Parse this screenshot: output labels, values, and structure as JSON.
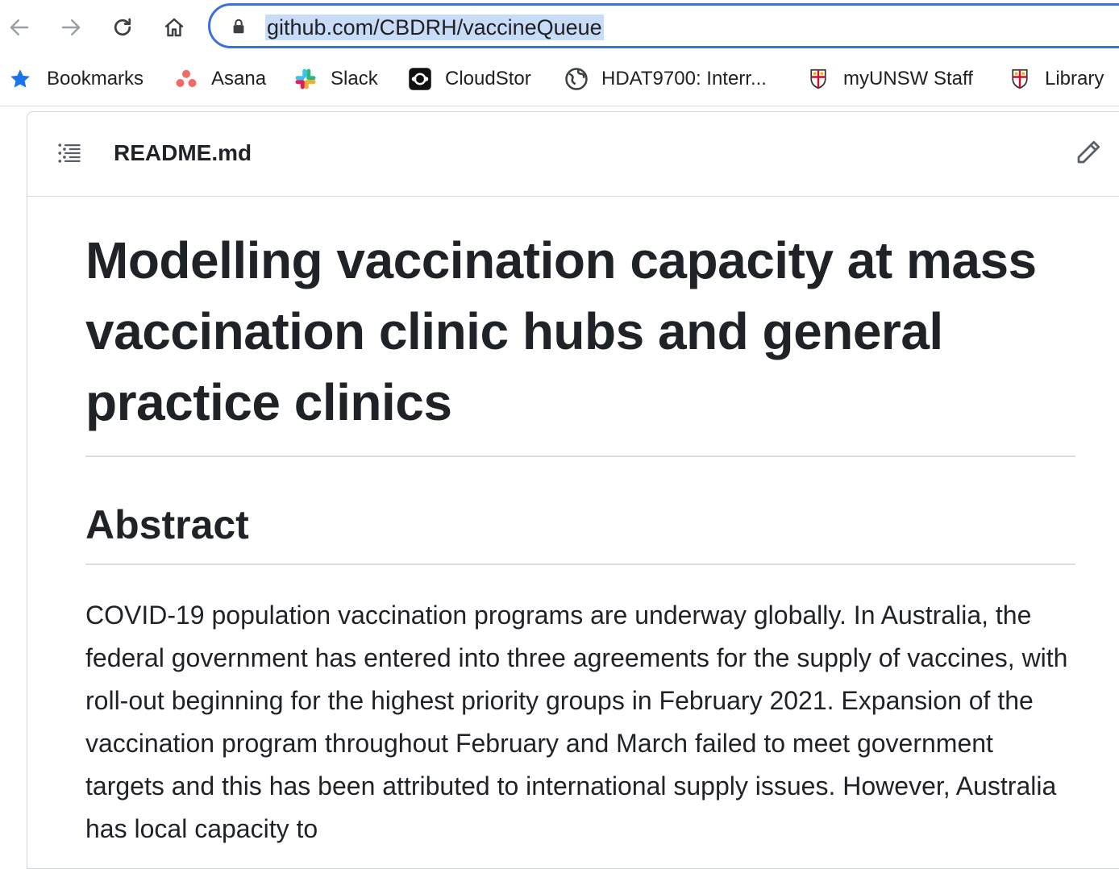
{
  "browser": {
    "url": "github.com/CBDRH/vaccineQueue",
    "nav": {
      "back_icon": "arrow-left-icon",
      "forward_icon": "arrow-right-icon",
      "reload_icon": "reload-icon",
      "home_icon": "home-icon"
    },
    "bookmarks": [
      {
        "label": "Bookmarks",
        "icon": "star-icon"
      },
      {
        "label": "Asana",
        "icon": "asana-icon"
      },
      {
        "label": "Slack",
        "icon": "slack-icon"
      },
      {
        "label": "CloudStor",
        "icon": "cloudstor-icon"
      },
      {
        "label": "HDAT9700: Interr...",
        "icon": "globe-icon"
      },
      {
        "label": "myUNSW Staff",
        "icon": "unsw-crest-icon"
      },
      {
        "label": "Library",
        "icon": "unsw-crest-icon"
      }
    ]
  },
  "readme": {
    "filename": "README.md",
    "title": "Modelling vaccination capacity at mass vaccination clinic hubs and general practice clinics",
    "section_heading": "Abstract",
    "abstract_visible": "COVID-19 population vaccination programs are underway globally. In Australia, the federal government has entered into three agreements for the supply of vaccines, with roll-out beginning for the highest priority groups in February 2021. Expansion of the vaccination program throughout February and March failed to meet government targets and this has been attributed to international supply issues. However, Australia has local capacity to"
  },
  "colors": {
    "accent": "#3b6fd9",
    "url_highlight": "#c9dcf7",
    "text": "#1f2328",
    "border": "#d0d7de"
  }
}
